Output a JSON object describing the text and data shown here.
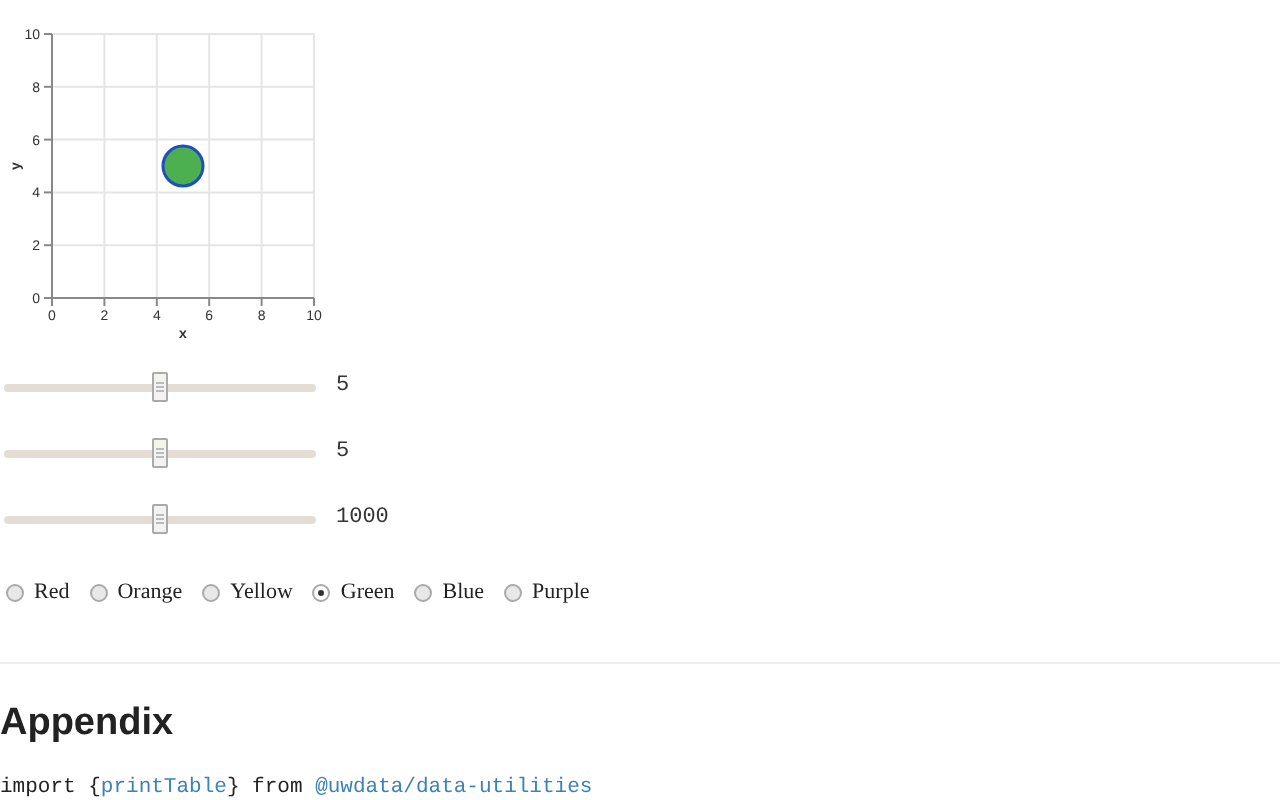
{
  "chart": {
    "chart_data": {
      "type": "scatter",
      "xlabel": "x",
      "ylabel": "y",
      "x": [
        5
      ],
      "series": [
        {
          "color": "#4caf50",
          "values": [
            5
          ]
        }
      ],
      "grid": true,
      "xlim": [
        0,
        10
      ],
      "ylim": [
        0,
        10
      ],
      "xticks": [
        0,
        2,
        4,
        6,
        8,
        10
      ],
      "yticks": [
        0,
        2,
        4,
        6,
        8,
        10
      ]
    }
  },
  "sliders": [
    {
      "level": 0.5,
      "reading": "5"
    },
    {
      "level": 0.5,
      "reading": "5"
    },
    {
      "level": 0.5,
      "reading": "1000"
    }
  ],
  "colors": [
    {
      "label": "Red",
      "selected": false
    },
    {
      "label": "Orange",
      "selected": false
    },
    {
      "label": "Yellow",
      "selected": false
    },
    {
      "label": "Green",
      "selected": true
    },
    {
      "label": "Blue",
      "selected": false
    },
    {
      "label": "Purple",
      "selected": false
    }
  ],
  "appendix": {
    "heading": "Appendix",
    "import": {
      "keyword": "import {",
      "name": "printTable",
      "middle": "} from",
      "module": "@uwdata/data-utilities"
    }
  }
}
